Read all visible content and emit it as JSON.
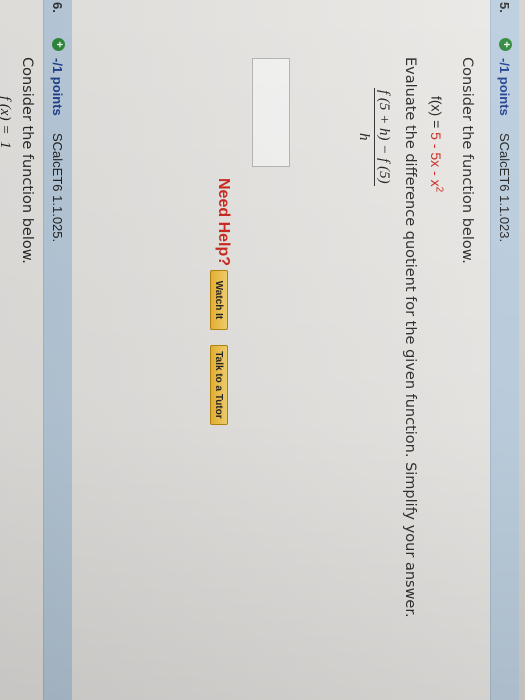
{
  "question5": {
    "number": "5.",
    "points": "-/1 points",
    "source": "SCalcET6 1.1.023.",
    "intro": "Consider the function below.",
    "function_lhs": "f(x) = ",
    "function_rhs_a": "5 - 5x - x",
    "function_rhs_exp": "2",
    "instruction": "Evaluate the difference quotient for the given function. Simplify your answer.",
    "fraction_numerator": "f (5 + h) − f (5)",
    "fraction_denominator": "h",
    "need_help": "Need Help?",
    "watch_label": "Watch It",
    "tutor_label": "Talk to a Tutor"
  },
  "question6": {
    "number": "6.",
    "points": "-/1 points",
    "source": "SCalcET6 1.1.025.",
    "intro": "Consider the function below.",
    "function_partial": "f (x) = ",
    "fraction_numerator": "1"
  }
}
